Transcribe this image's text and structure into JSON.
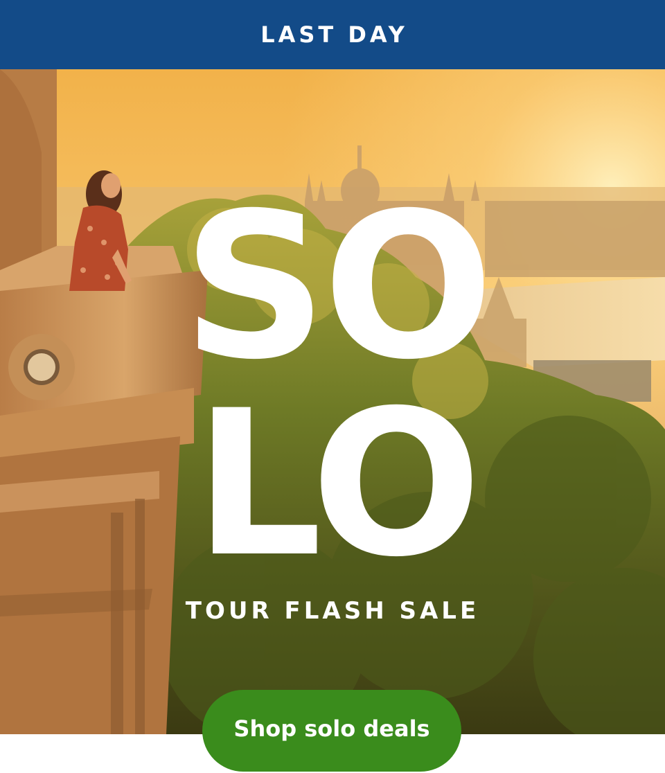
{
  "banner": {
    "text": "LAST DAY",
    "background_color": "#134b88"
  },
  "hero": {
    "image_alt": "Traveler on a stone balcony overlooking a city and river at sunrise",
    "headline_line1": "SO",
    "headline_line2": "LO",
    "subtitle": "TOUR FLASH SALE"
  },
  "cta": {
    "label": "Shop solo deals",
    "color": "#3a8c1c"
  }
}
